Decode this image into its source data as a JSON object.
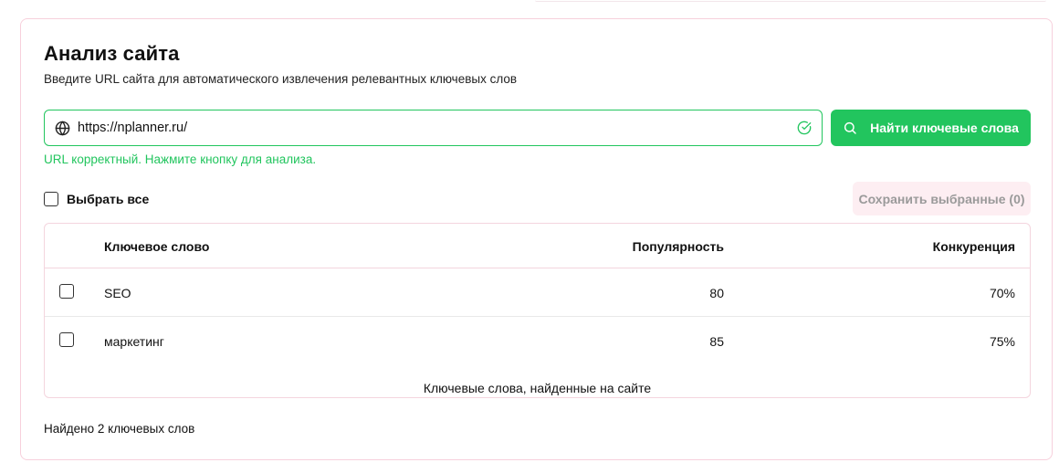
{
  "header": {
    "title": "Анализ сайта",
    "subtitle": "Введите URL сайта для автоматического извлечения релевантных ключевых слов"
  },
  "url_input": {
    "value": "https://nplanner.ru/",
    "left_icon": "globe-icon",
    "status_icon": "check-circle-icon"
  },
  "search_button": {
    "label": "Найти ключевые слова",
    "icon": "search-icon"
  },
  "validation_message": "URL корректный. Нажмите кнопку для анализа.",
  "select_all": {
    "label": "Выбрать все",
    "checked": false
  },
  "save_button": {
    "label": "Сохранить выбранные (0)",
    "disabled": true
  },
  "table": {
    "columns": [
      "Ключевое слово",
      "Популярность",
      "Конкуренция"
    ],
    "rows": [
      {
        "keyword": "SEO",
        "popularity": "80",
        "competition": "70%",
        "checked": false
      },
      {
        "keyword": "маркетинг",
        "popularity": "85",
        "competition": "75%",
        "checked": false
      }
    ],
    "caption": "Ключевые слова, найденные на сайте"
  },
  "summary": "Найдено 2 ключевых слов",
  "colors": {
    "accent_green": "#22c55e",
    "card_border_pink": "#f7d0dc",
    "save_button_bg": "#fdeef2"
  }
}
